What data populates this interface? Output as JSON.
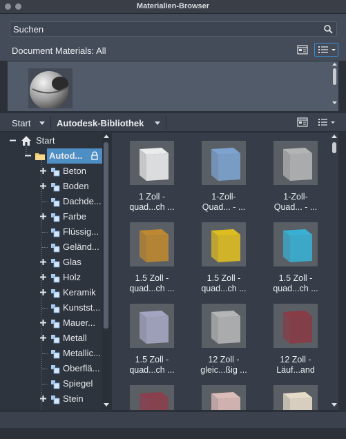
{
  "window": {
    "title": "Materialien-Browser"
  },
  "search": {
    "placeholder": "Suchen"
  },
  "document": {
    "label": "Document Materials: All"
  },
  "library_bar": {
    "start": "Start",
    "library": "Autodesk-Bibliothek"
  },
  "tree": {
    "items": [
      {
        "label": "Start",
        "icon": "home-icon",
        "expander": "minus"
      },
      {
        "label": "Autod...",
        "icon": "folder-icon",
        "expander": "minus",
        "selected": true,
        "locked": true
      },
      {
        "label": "Beton",
        "icon": "material-category-icon",
        "expander": "plus"
      },
      {
        "label": "Boden",
        "icon": "material-category-icon",
        "expander": "plus"
      },
      {
        "label": "Dachde...",
        "icon": "material-category-icon",
        "expander": "none"
      },
      {
        "label": "Farbe",
        "icon": "material-category-icon",
        "expander": "plus"
      },
      {
        "label": "Flüssig...",
        "icon": "material-category-icon",
        "expander": "none"
      },
      {
        "label": "Geländ...",
        "icon": "material-category-icon",
        "expander": "none"
      },
      {
        "label": "Glas",
        "icon": "material-category-icon",
        "expander": "plus"
      },
      {
        "label": "Holz",
        "icon": "material-category-icon",
        "expander": "plus"
      },
      {
        "label": "Keramik",
        "icon": "material-category-icon",
        "expander": "plus"
      },
      {
        "label": "Kunstst...",
        "icon": "material-category-icon",
        "expander": "none"
      },
      {
        "label": "Mauer...",
        "icon": "material-category-icon",
        "expander": "plus"
      },
      {
        "label": "Metall",
        "icon": "material-category-icon",
        "expander": "plus"
      },
      {
        "label": "Metallic...",
        "icon": "material-category-icon",
        "expander": "none"
      },
      {
        "label": "Oberflä...",
        "icon": "material-category-icon",
        "expander": "none"
      },
      {
        "label": "Spiegel",
        "icon": "material-category-icon",
        "expander": "none"
      },
      {
        "label": "Stein",
        "icon": "material-category-icon",
        "expander": "plus"
      }
    ]
  },
  "materials": [
    {
      "line1": "1 Zoll -",
      "line2": "quad...ch ...",
      "color": "#f2f2f2"
    },
    {
      "line1": "1-Zoll-",
      "line2": "Quad... - ...",
      "color": "#7fa7d6"
    },
    {
      "line1": "1-Zoll-",
      "line2": "Quad... - ...",
      "color": "#b8b8b8"
    },
    {
      "line1": "1.5 Zoll -",
      "line2": "quad...ch ...",
      "color": "#c38a2e"
    },
    {
      "line1": "1.5 Zoll -",
      "line2": "quad...ch ...",
      "color": "#e5c21d"
    },
    {
      "line1": "1.5 Zoll -",
      "line2": "quad...ch ...",
      "color": "#38b4d9"
    },
    {
      "line1": "1.5 Zoll -",
      "line2": "quad...ch ...",
      "color": "#a9a9c6"
    },
    {
      "line1": "12 Zoll -",
      "line2": "gleic...ßig ...",
      "color": "#b9b9b9"
    },
    {
      "line1": "12 Zoll -",
      "line2": "Läuf...and",
      "color": "#8a3a45"
    },
    {
      "line1": "",
      "line2": "",
      "color": "#8d3d4b"
    },
    {
      "line1": "",
      "line2": "",
      "color": "#e4c1bd"
    },
    {
      "line1": "",
      "line2": "",
      "color": "#ede2cf"
    }
  ]
}
